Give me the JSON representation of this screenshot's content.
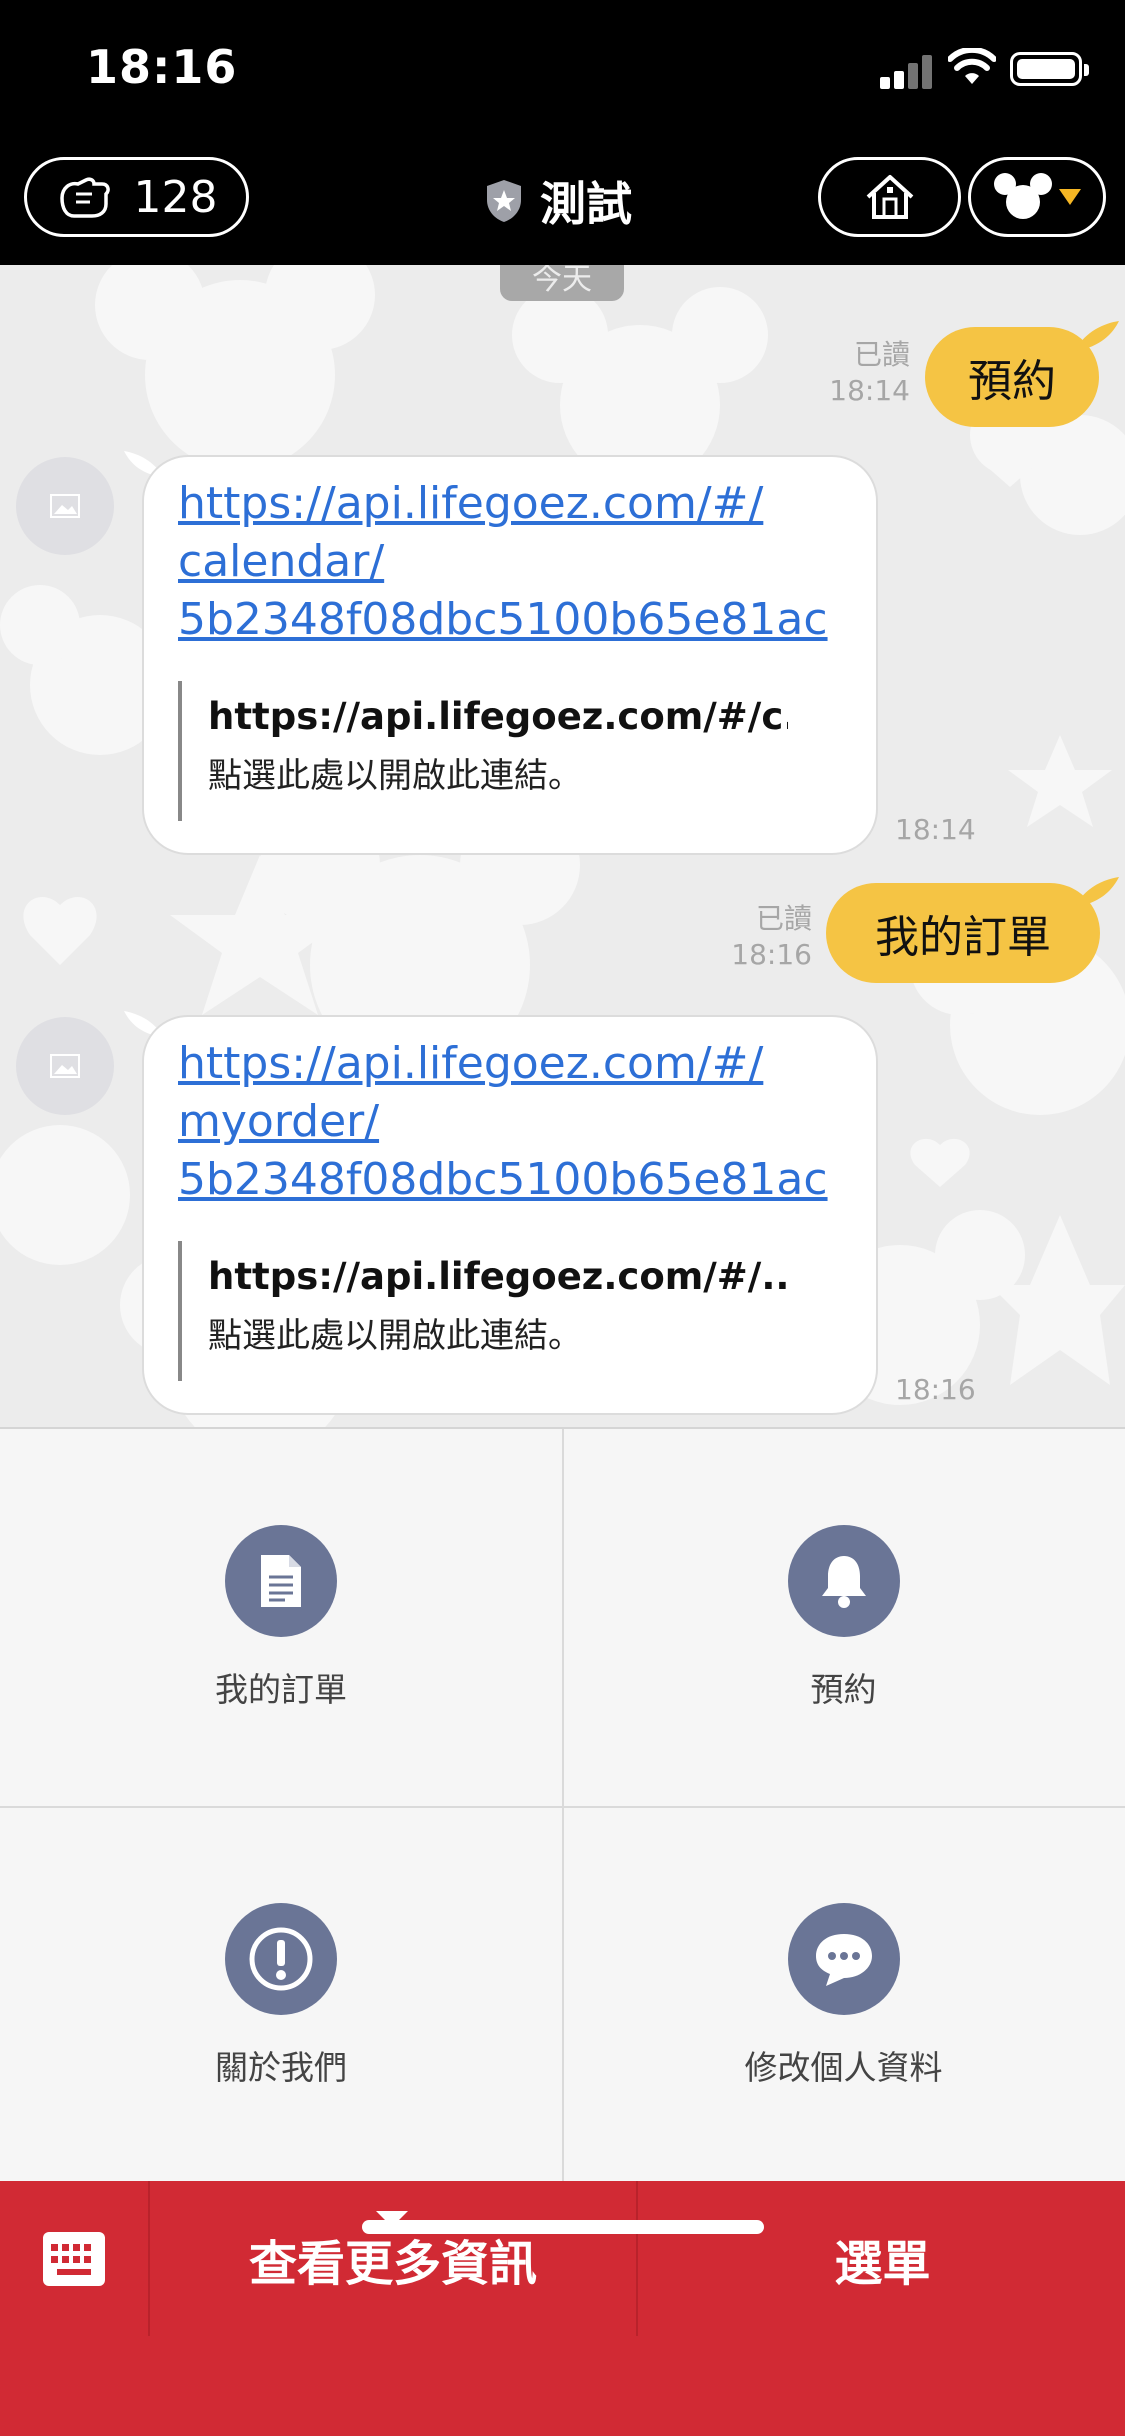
{
  "status_bar": {
    "time": "18:16"
  },
  "header": {
    "coins": "128",
    "title": "測試"
  },
  "chat": {
    "date_label": "今天",
    "messages": [
      {
        "type": "out",
        "text": "預約",
        "read": "已讀",
        "time": "18:14"
      },
      {
        "type": "in",
        "link_lines": [
          "https://api.lifegoez.com/#/",
          "calendar/",
          "5b2348f08dbc5100b65e81ac"
        ],
        "preview_title": "https://api.lifegoez.com/#/c...",
        "preview_sub": "點選此處以開啟此連結。",
        "time": "18:14"
      },
      {
        "type": "out",
        "text": "我的訂單",
        "read": "已讀",
        "time": "18:16"
      },
      {
        "type": "in",
        "link_lines": [
          "https://api.lifegoez.com/#/",
          "myorder/",
          "5b2348f08dbc5100b65e81ac"
        ],
        "preview_title": "https://api.lifegoez.com/#/...",
        "preview_sub": "點選此處以開啟此連結。",
        "time": "18:16"
      }
    ]
  },
  "menu": {
    "items": [
      {
        "label": "我的訂單",
        "icon": "document-icon"
      },
      {
        "label": "預約",
        "icon": "bell-icon"
      },
      {
        "label": "關於我們",
        "icon": "info-exclamation-icon"
      },
      {
        "label": "修改個人資料",
        "icon": "chat-bubble-icon"
      }
    ]
  },
  "bottom_bar": {
    "more_info": "查看更多資訊",
    "menu": "選單"
  },
  "colors": {
    "brand_red": "#d12a34",
    "outgoing_bubble": "#f5c444",
    "link": "#2d6fd6",
    "menu_icon_bg": "#6a7596"
  }
}
